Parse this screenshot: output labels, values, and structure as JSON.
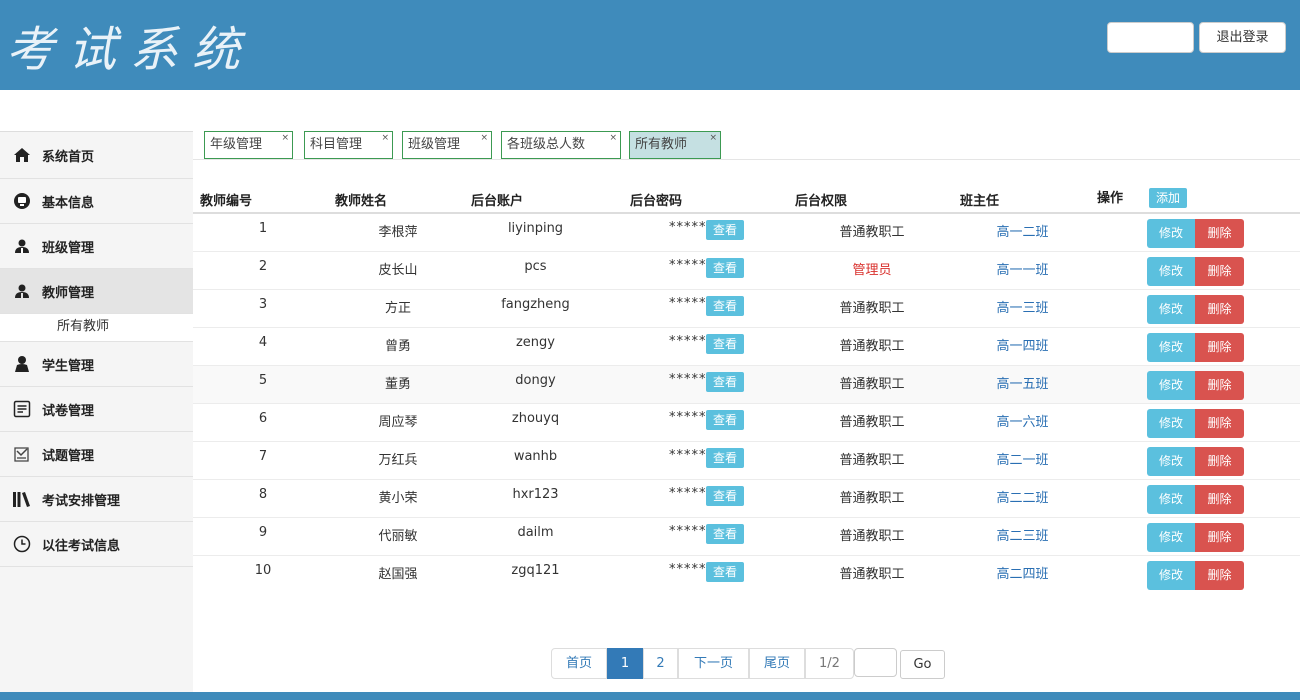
{
  "header": {
    "logo": "考试系统",
    "logout_label": "退出登录"
  },
  "sidebar": {
    "items": [
      {
        "label": "系统首页",
        "icon": "home-icon"
      },
      {
        "label": "基本信息",
        "icon": "info-icon"
      },
      {
        "label": "班级管理",
        "icon": "users-icon"
      },
      {
        "label": "教师管理",
        "icon": "users-icon",
        "active": true
      },
      {
        "label": "学生管理",
        "icon": "user-icon"
      },
      {
        "label": "试卷管理",
        "icon": "paper-icon"
      },
      {
        "label": "试题管理",
        "icon": "questions-icon"
      },
      {
        "label": "考试安排管理",
        "icon": "books-icon"
      },
      {
        "label": "以往考试信息",
        "icon": "clock-icon"
      }
    ],
    "sub_item": "所有教师"
  },
  "tabs": [
    {
      "label": "年级管理"
    },
    {
      "label": "科目管理"
    },
    {
      "label": "班级管理"
    },
    {
      "label": "各班级总人数"
    },
    {
      "label": "所有教师",
      "active": true
    }
  ],
  "tab_close": "×",
  "table": {
    "headers": {
      "id": "教师编号",
      "name": "教师姓名",
      "account": "后台账户",
      "password": "后台密码",
      "role": "后台权限",
      "class": "班主任",
      "ops": "操作"
    },
    "add_label": "添加",
    "view_label": "查看",
    "edit_label": "修改",
    "delete_label": "删除",
    "rows": [
      {
        "id": "1",
        "name": "李根萍",
        "account": "liyinping",
        "password": "******",
        "role": "普通教职工",
        "class": "高一二班"
      },
      {
        "id": "2",
        "name": "皮长山",
        "account": "pcs",
        "password": "******",
        "role": "管理员",
        "class": "高一一班"
      },
      {
        "id": "3",
        "name": "方正",
        "account": "fangzheng",
        "password": "******",
        "role": "普通教职工",
        "class": "高一三班"
      },
      {
        "id": "4",
        "name": "曾勇",
        "account": "zengy",
        "password": "******",
        "role": "普通教职工",
        "class": "高一四班"
      },
      {
        "id": "5",
        "name": "董勇",
        "account": "dongy",
        "password": "******",
        "role": "普通教职工",
        "class": "高一五班"
      },
      {
        "id": "6",
        "name": "周应琴",
        "account": "zhouyq",
        "password": "******",
        "role": "普通教职工",
        "class": "高一六班"
      },
      {
        "id": "7",
        "name": "万红兵",
        "account": "wanhb",
        "password": "******",
        "role": "普通教职工",
        "class": "高二一班"
      },
      {
        "id": "8",
        "name": "黄小荣",
        "account": "hxr123",
        "password": "******",
        "role": "普通教职工",
        "class": "高二二班"
      },
      {
        "id": "9",
        "name": "代丽敏",
        "account": "dailm",
        "password": "******",
        "role": "普通教职工",
        "class": "高二三班"
      },
      {
        "id": "10",
        "name": "赵国强",
        "account": "zgq121",
        "password": "******",
        "role": "普通教职工",
        "class": "高二四班"
      }
    ]
  },
  "pagination": {
    "first": "首页",
    "page1": "1",
    "page2": "2",
    "next": "下一页",
    "last": "尾页",
    "page_info": "1/2",
    "go": "Go"
  },
  "colors": {
    "header_bg": "#3f8bbb",
    "info_button": "#5bc0de",
    "danger_button": "#d9534f",
    "admin_text": "#d9302c",
    "link_text": "#2a6fb3",
    "tab_border": "#3c9a52"
  }
}
